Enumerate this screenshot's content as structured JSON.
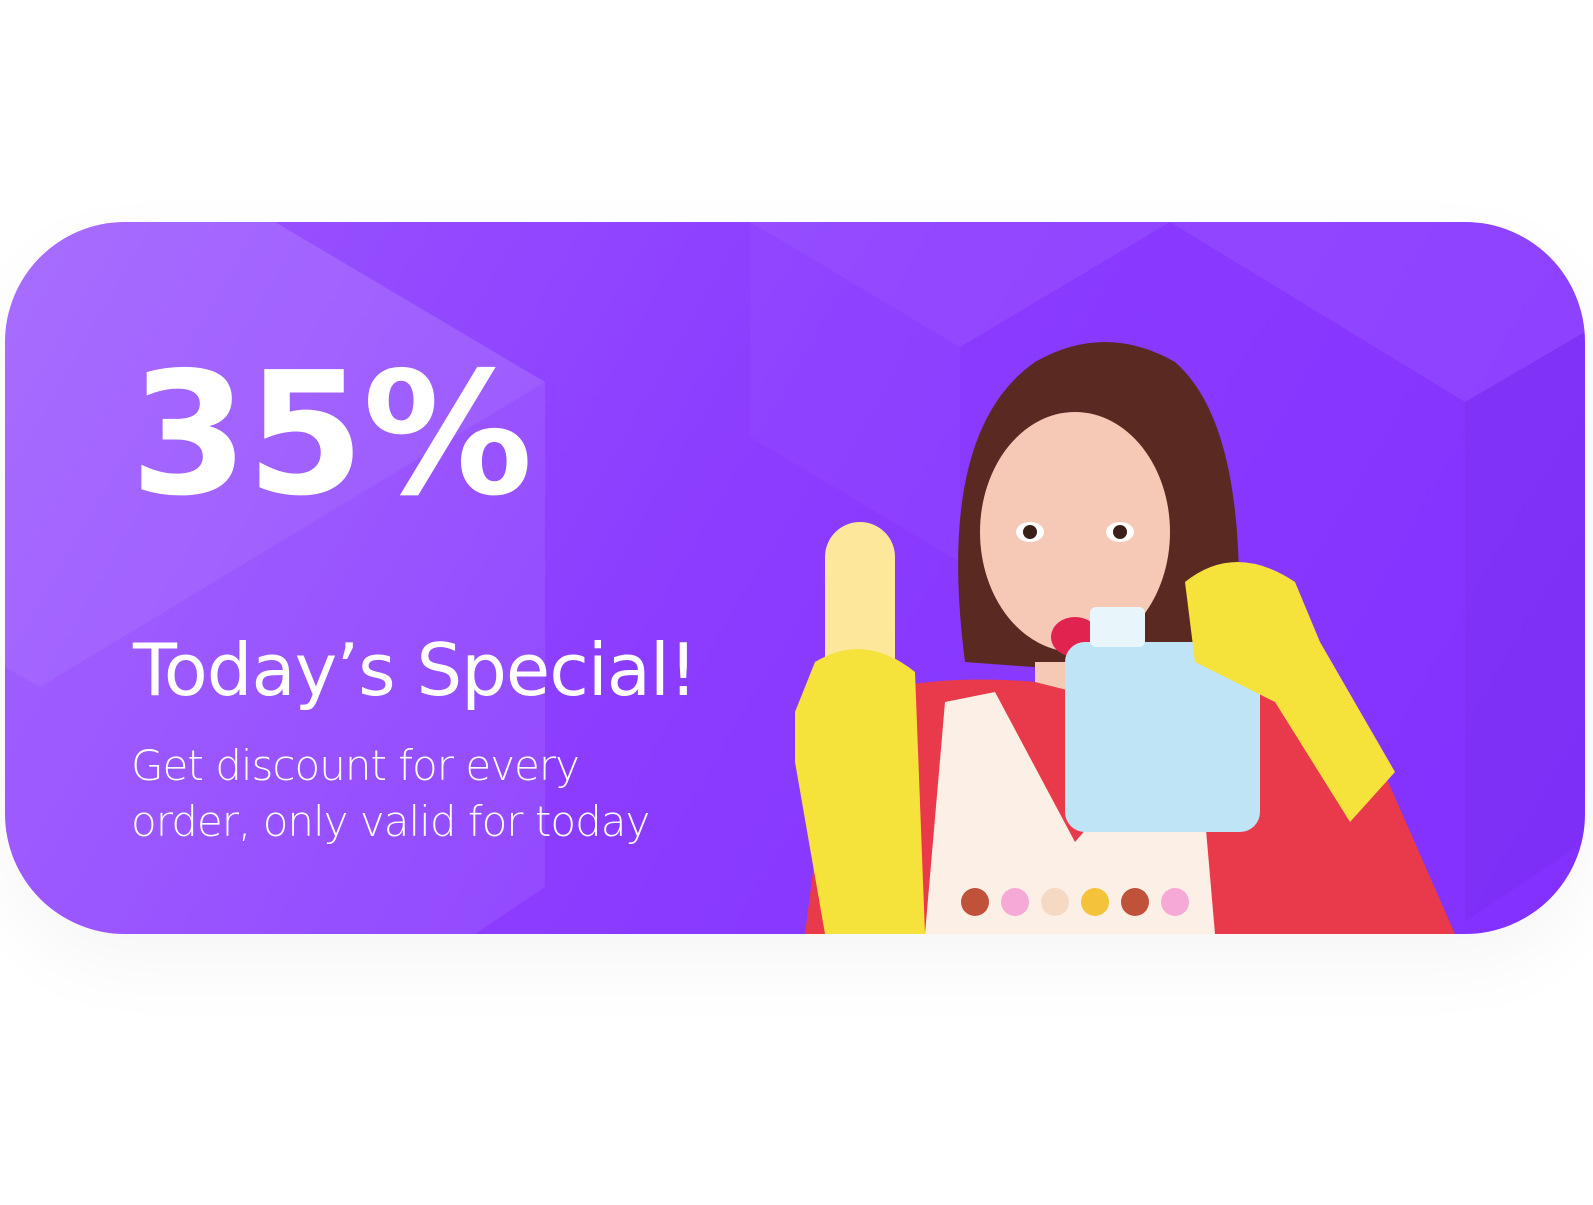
{
  "promo": {
    "discount": "35%",
    "title": "Today’s Special!",
    "description": "Get discount for every order, only valid for today"
  },
  "colors": {
    "background": "#8b3cff",
    "text": "#ffffff"
  }
}
